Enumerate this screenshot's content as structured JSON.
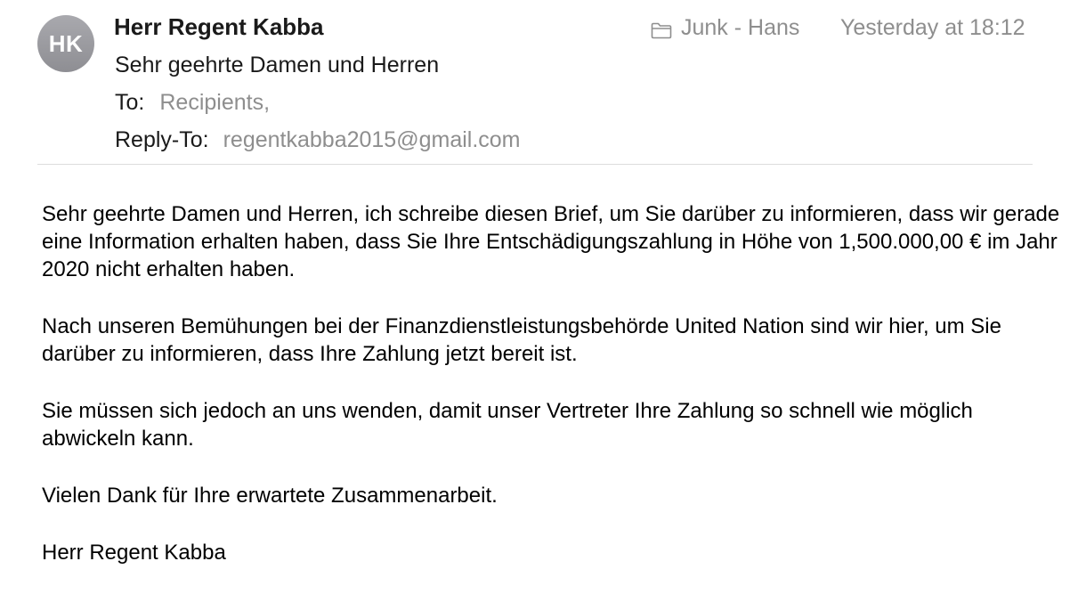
{
  "message": {
    "avatar_initials": "HK",
    "sender_name": "Herr Regent Kabba",
    "subject": "Sehr geehrte Damen und Herren",
    "mailbox": "Junk - Hans",
    "date": "Yesterday at 18:12",
    "to_label": "To:",
    "to_value": "Recipients,",
    "reply_to_label": "Reply-To:",
    "reply_to_value": "regentkabba2015@gmail.com"
  },
  "body": {
    "paragraphs": [
      "Sehr geehrte Damen und Herren, ich schreibe diesen Brief, um Sie darüber zu informieren, dass wir gerade eine Information erhalten haben, dass Sie Ihre Entschädigungszahlung in Höhe von 1,500.000,00 € im Jahr 2020 nicht erhalten haben.",
      "Nach unseren Bemühungen bei der Finanzdienstleistungsbehörde United Nation sind wir hier, um Sie darüber zu informieren, dass Ihre Zahlung jetzt bereit ist.",
      "Sie müssen sich jedoch an uns wenden, damit unser Vertreter Ihre Zahlung so schnell wie möglich abwickeln kann.",
      "Vielen Dank für Ihre erwartete Zusammenarbeit.",
      "Herr Regent Kabba"
    ]
  },
  "icons": {
    "folder": "folder-icon"
  },
  "colors": {
    "secondary_text": "#8e8e8e",
    "avatar_bg": "#9a9a9f",
    "divider": "#dcdcdc"
  }
}
